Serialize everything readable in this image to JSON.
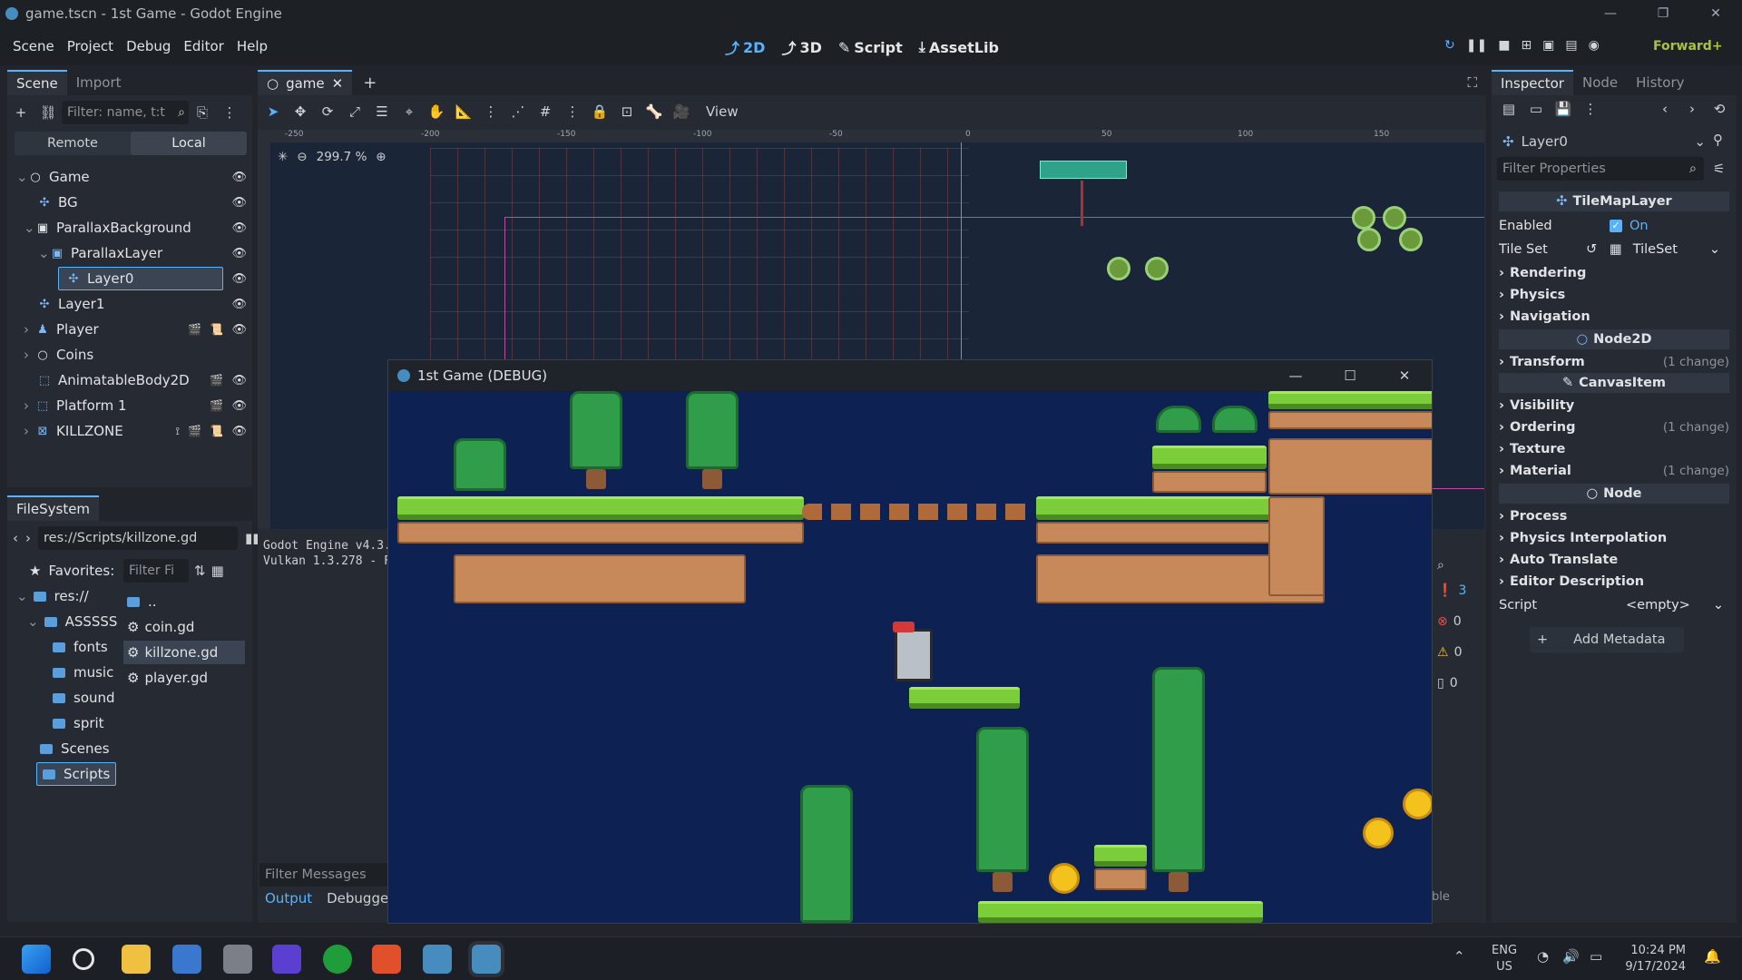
{
  "window": {
    "title": "game.tscn - 1st Game - Godot Engine"
  },
  "menu": {
    "items": [
      "Scene",
      "Project",
      "Debug",
      "Editor",
      "Help"
    ]
  },
  "modes": {
    "d2": "2D",
    "d3": "3D",
    "script": "Script",
    "assetlib": "AssetLib"
  },
  "renderer": "Forward+",
  "scene_dock": {
    "tabs": [
      "Scene",
      "Import"
    ],
    "filter_placeholder": "Filter: name, t:t",
    "remote": "Remote",
    "local": "Local",
    "nodes": [
      "Game",
      "BG",
      "ParallaxBackground",
      "ParallaxLayer",
      "Layer0",
      "Layer1",
      "Player",
      "Coins",
      "AnimatableBody2D",
      "Platform 1",
      "KILLZONE"
    ]
  },
  "filesystem": {
    "title": "FileSystem",
    "path": "res://Scripts/killzone.gd",
    "favorites": "Favorites:",
    "filter_placeholder": "Filter Fi",
    "tree": [
      "res://",
      "ASSSSS",
      "fonts",
      "music",
      "sound",
      "sprit",
      "Scenes",
      "Scripts"
    ],
    "files": [
      "..",
      "coin.gd",
      "killzone.gd",
      "player.gd"
    ]
  },
  "editor": {
    "tab": "game",
    "view": "View",
    "zoom": "299.7 %",
    "ruler": [
      "-250",
      "-200",
      "-150",
      "-100",
      "-50",
      "0",
      "50",
      "100",
      "150"
    ]
  },
  "output": {
    "line1": "Godot Engine v4.3.",
    "line2": "Vulkan 1.3.278 - F",
    "filter": "Filter Messages",
    "tab_output": "Output",
    "tab_debugger": "Debugger",
    "counts": [
      "3",
      "0",
      "0",
      "0"
    ],
    "ble": "ble"
  },
  "game_window": {
    "title": "1st Game (DEBUG)"
  },
  "inspector": {
    "tabs": [
      "Inspector",
      "Node",
      "History"
    ],
    "object": "Layer0",
    "filter_placeholder": "Filter Properties",
    "class_tilemap": "TileMapLayer",
    "enabled_label": "Enabled",
    "enabled_value": "On",
    "tileset_label": "Tile Set",
    "tileset_value": "TileSet",
    "sections1": [
      "Rendering",
      "Physics",
      "Navigation"
    ],
    "class_node2d": "Node2D",
    "transform": "Transform",
    "change": "(1 change)",
    "class_canvasitem": "CanvasItem",
    "visibility": "Visibility",
    "ordering": "Ordering",
    "texture": "Texture",
    "material": "Material",
    "class_node": "Node",
    "sections3": [
      "Process",
      "Physics Interpolation",
      "Auto Translate",
      "Editor Description"
    ],
    "script_label": "Script",
    "script_value": "<empty>",
    "add_metadata": "Add Metadata"
  },
  "taskbar": {
    "lang1": "ENG",
    "lang2": "US",
    "time": "10:24 PM",
    "date": "9/17/2024"
  }
}
